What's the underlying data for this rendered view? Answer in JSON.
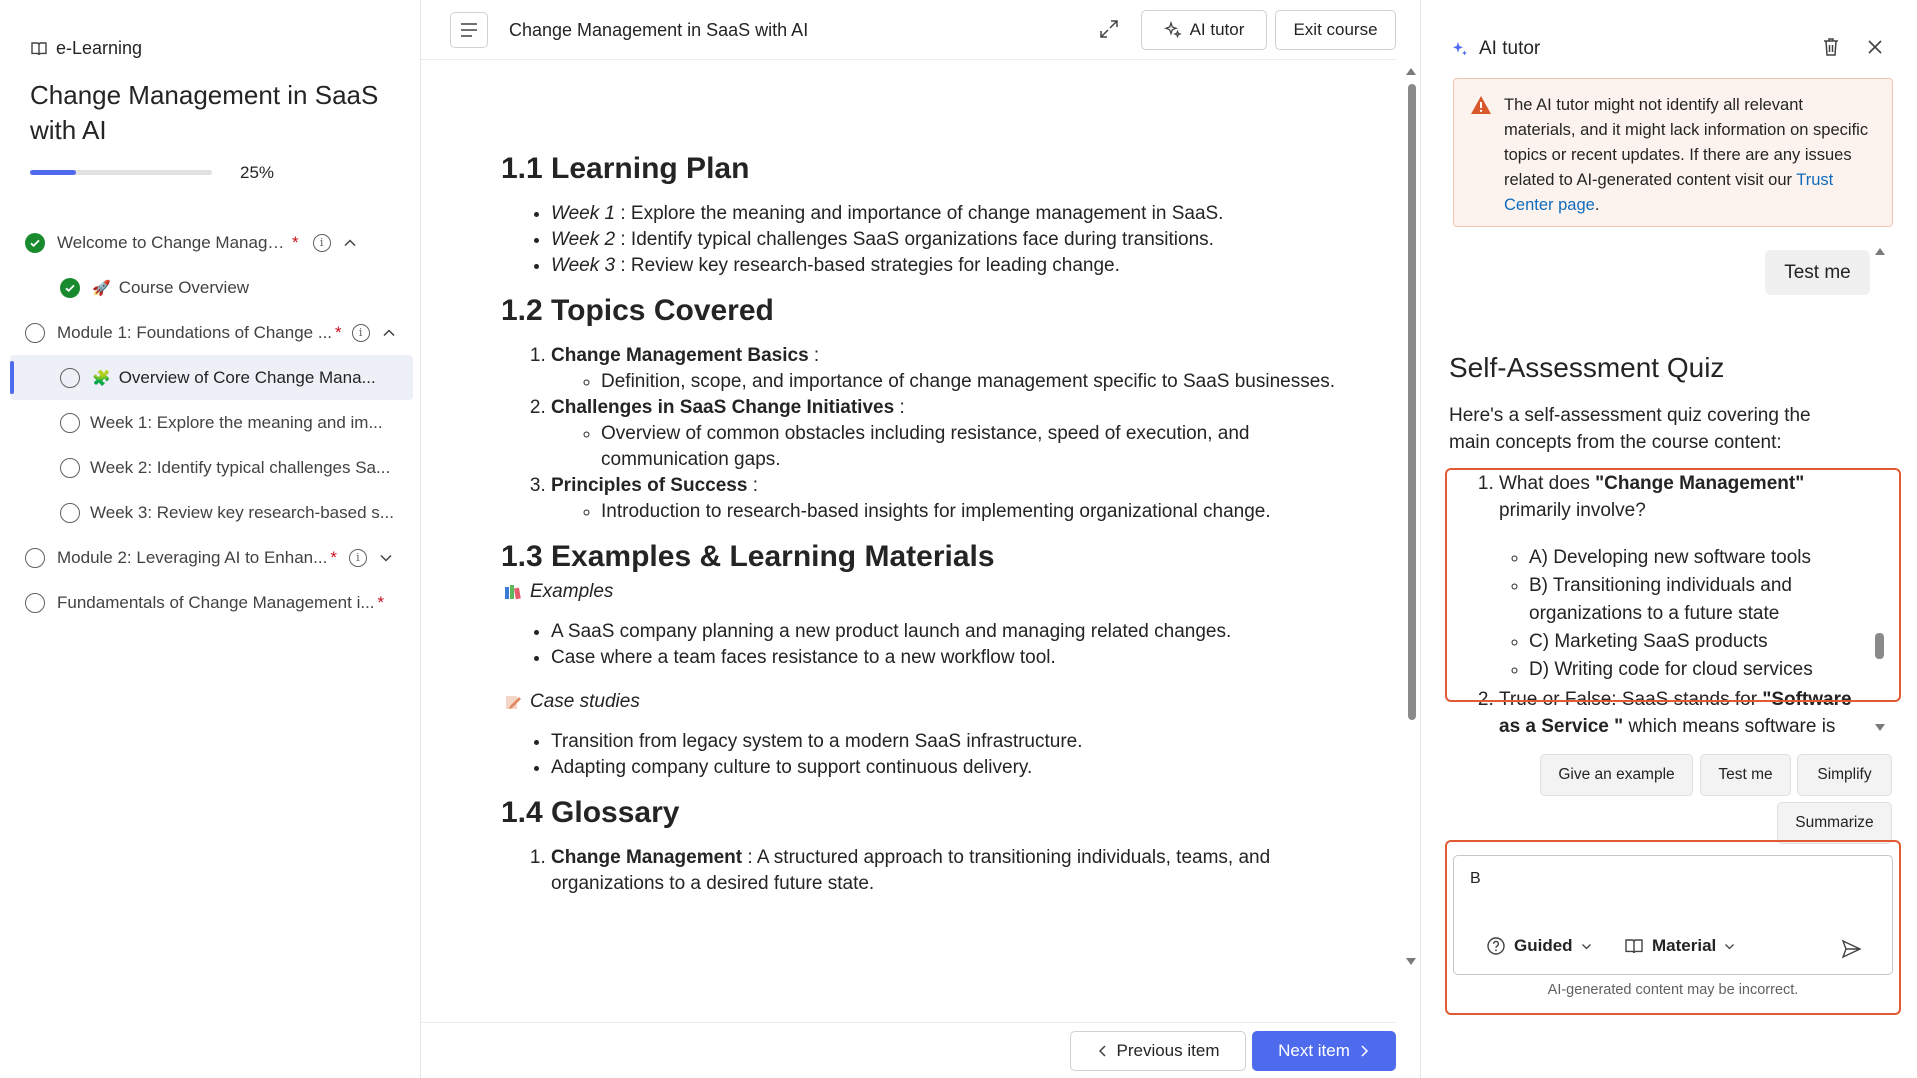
{
  "sidebar": {
    "brand": "e-Learning",
    "course_title": "Change Management in SaaS with AI",
    "progress_percent": 25,
    "progress_label": "25%",
    "items": [
      {
        "label": "Welcome to Change Management...",
        "required": "*",
        "status": "complete"
      },
      {
        "label": "Course Overview",
        "status": "complete",
        "emoji": "🚀"
      },
      {
        "label": "Module 1: Foundations of Change ...",
        "required": "*",
        "status": "incomplete"
      },
      {
        "label": "Overview of Core Change Mana...",
        "status": "incomplete",
        "emoji": "🧩",
        "selected": true
      },
      {
        "label": "Week 1: Explore the meaning and im...",
        "status": "incomplete"
      },
      {
        "label": "Week 2: Identify typical challenges Sa...",
        "status": "incomplete"
      },
      {
        "label": "Week 3: Review key research-based s...",
        "status": "incomplete"
      },
      {
        "label": "Module 2: Leveraging AI to Enhan...",
        "required": "*",
        "status": "incomplete"
      },
      {
        "label": "Fundamentals of Change Management i...",
        "required": "*",
        "status": "incomplete"
      }
    ]
  },
  "topbar": {
    "title": "Change Management in SaaS with AI",
    "ai_tutor_label": "AI tutor",
    "exit_label": "Exit course"
  },
  "article": {
    "s1_title": "1.1 Learning Plan",
    "s1_items": [
      {
        "week": "Week 1",
        "text": " : Explore the meaning and importance of change management in SaaS."
      },
      {
        "week": "Week 2",
        "text": " : Identify typical challenges SaaS organizations face during transitions."
      },
      {
        "week": "Week 3",
        "text": " : Review key research-based strategies for leading change."
      }
    ],
    "s2_title": "1.2 Topics Covered",
    "s2_items": [
      {
        "head": "Change Management Basics",
        "sep": " :",
        "sub": "Definition, scope, and importance of change management specific to SaaS businesses."
      },
      {
        "head": "Challenges in SaaS Change Initiatives",
        "sep": " :",
        "sub": "Overview of common obstacles including resistance, speed of execution, and communication gaps."
      },
      {
        "head": "Principles of Success",
        "sep": " :",
        "sub": "Introduction to research-based insights for implementing organizational change."
      }
    ],
    "s3_title": "1.3 Examples & Learning Materials",
    "examples_caption": "Examples",
    "examples": [
      "A SaaS company planning a new product launch and managing related changes.",
      "Case where a team faces resistance to a new workflow tool."
    ],
    "cases_caption": "Case studies",
    "cases": [
      "Transition from legacy system to a modern SaaS infrastructure.",
      "Adapting company culture to support continuous delivery."
    ],
    "s4_title": "1.4 Glossary",
    "glossary_term": "Change Management",
    "glossary_def": " : A structured approach to transitioning individuals, teams, and organizations to a desired future state."
  },
  "footer": {
    "prev_label": "Previous item",
    "next_label": "Next item"
  },
  "tutor": {
    "title": "AI tutor",
    "warning_text": "The AI tutor might not identify all relevant materials, and it might lack information on specific topics or recent updates. If there are any issues related to AI-generated content visit our ",
    "warning_link": "Trust Center page",
    "warning_end": ".",
    "user_message": "Test me",
    "quiz_title": "Self-Assessment Quiz",
    "quiz_intro": "Here's a self-assessment quiz covering the main concepts from the course content:",
    "q1_pre": "What does ",
    "q1_bold": "\"Change Management\"",
    "q1_post": " primarily involve?",
    "q1_options": [
      "A) Developing new software tools",
      "B) Transitioning individuals and organizations to a future state",
      "C) Marketing SaaS products",
      "D) Writing code for cloud services"
    ],
    "q2_pre": "True or False: SaaS stands for ",
    "q2_bold": "\"Software as a Service \"",
    "q2_post": " which means software is",
    "chips": [
      "Give an example",
      "Test me",
      "Simplify",
      "Summarize"
    ],
    "input_value": "B",
    "mode_label": "Guided",
    "source_label": "Material",
    "disclaimer": "AI-generated content may be incorrect."
  }
}
